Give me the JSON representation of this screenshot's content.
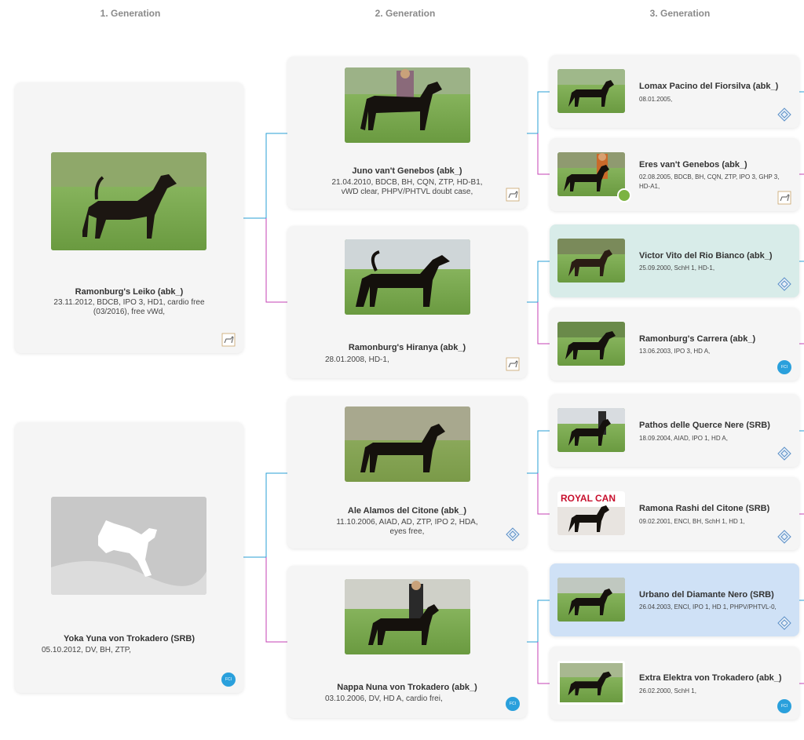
{
  "headers": [
    "1. Generation",
    "2. Generation",
    "3. Generation"
  ],
  "colors": {
    "line_blue": "#2a9fd6",
    "line_magenta": "#c542b5",
    "card_bg": "#f5f5f5",
    "card_teal": "#d8ece9",
    "card_blue": "#cfe1f6",
    "fci_badge": "#2aa0dc",
    "video_badge": "#7cb342"
  },
  "gen1": [
    {
      "name": "Ramonburg's Leiko (abk_)",
      "info_line1": "23.11.2012, BDCB, IPO 3, HD1, cardio free",
      "info_line2": "(03/2016), free vWd,",
      "badge": "dog-icon"
    },
    {
      "name": "Yoka Yuna von Trokadero (SRB)",
      "info_line1": "05.10.2012, DV, BH, ZTP,",
      "badge": "fci-icon"
    }
  ],
  "gen2": [
    {
      "name": "Juno van't Genebos (abk_)",
      "info_line1": "21.04.2010, BDCB, BH, CQN, ZTP, HD-B1,",
      "info_line2": "vWD clear, PHPV/PHTVL doubt case,",
      "badge": "dog-icon"
    },
    {
      "name": "Ramonburg's Hiranya (abk_)",
      "info_line1": "28.01.2008, HD-1,",
      "badge": "dog-icon"
    },
    {
      "name": "Ale Alamos del Citone (abk_)",
      "info_line1": "11.10.2006, AIAD, AD, ZTP, IPO 2, HDA,",
      "info_line2": "eyes free,",
      "badge": "diamond-icon"
    },
    {
      "name": "Nappa Nuna von Trokadero (abk_)",
      "info_line1": "03.10.2006, DV, HD A, cardio frei,",
      "badge": "fci-icon"
    }
  ],
  "gen3": [
    {
      "name": "Lomax Pacino del Fiorsilva (abk_)",
      "info_line1": "08.01.2005,",
      "badge": "diamond-icon"
    },
    {
      "name": "Eres van't Genebos (abk_)",
      "info_line1": "02.08.2005, BDCB, BH, CQN, ZTP, IPO 3, GHP 3,",
      "info_line2": "HD-A1,",
      "badge": "dog-icon"
    },
    {
      "name": "Victor Vito del Rio Bianco (abk_)",
      "info_line1": "25.09.2000, SchH 1, HD-1,",
      "badge": "diamond-icon"
    },
    {
      "name": "Ramonburg's Carrera (abk_)",
      "info_line1": "13.06.2003, IPO 3, HD A,",
      "badge": "fci-icon"
    },
    {
      "name": "Pathos delle Querce Nere (SRB)",
      "info_line1": "18.09.2004, AIAD, IPO 1, HD A,",
      "badge": "diamond-icon"
    },
    {
      "name": "Ramona Rashi del Citone (SRB)",
      "info_line1": "09.02.2001, ENCI, BH, SchH 1, HD 1,",
      "badge": "diamond-icon"
    },
    {
      "name": "Urbano del Diamante Nero (SRB)",
      "info_line1": "26.04.2003, ENCI, IPO 1, HD 1, PHPV/PHTVL-0,",
      "badge": "diamond-icon"
    },
    {
      "name": "Extra Elektra von Trokadero (abk_)",
      "info_line1": "26.02.2000, SchH 1,",
      "badge": "fci-icon"
    }
  ],
  "royal_canin_text": "ROYAL CAN"
}
